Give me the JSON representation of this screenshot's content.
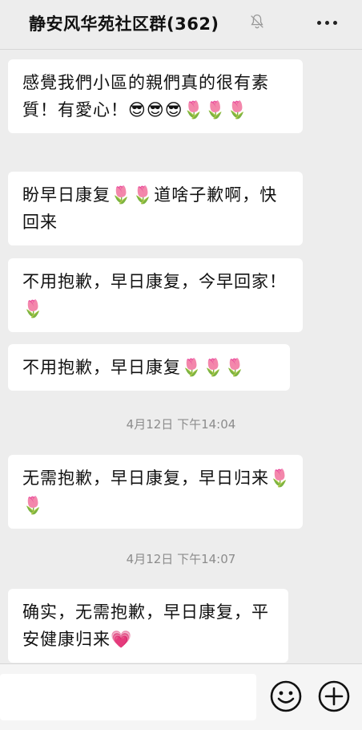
{
  "header": {
    "title": "静安风华苑社区群(362)"
  },
  "messages": [
    {
      "text": "感覺我們小區的親們真的很有素質！有愛心！😎😎😎🌷🌷🌷"
    },
    {
      "text": "盼早日康复🌷🌷道啥子歉啊，快回来"
    },
    {
      "text": "不用抱歉，早日康复，今早回家！🌷"
    },
    {
      "text": "不用抱歉，早日康复🌷🌷🌷"
    },
    {
      "timestamp": "4月12日 下午14:04"
    },
    {
      "text": "无需抱歉，早日康复，早日归来🌷🌷"
    },
    {
      "timestamp": "4月12日 下午14:07"
    },
    {
      "text": "确实，无需抱歉，早日康复，平安健康归来💗"
    }
  ],
  "icons": {
    "mute": "bell-off-icon",
    "more": "more-dots-icon",
    "emoji": "smiley-icon",
    "plus": "plus-circle-icon"
  }
}
